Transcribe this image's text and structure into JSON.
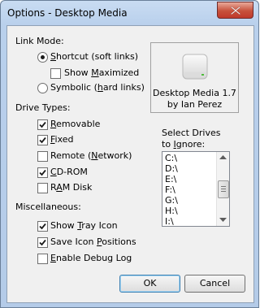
{
  "window": {
    "title": "Options - Desktop Media"
  },
  "link_mode": {
    "heading": "Link Mode:",
    "shortcut_pre": "",
    "shortcut_u": "S",
    "shortcut_post": "hortcut (soft links)",
    "show_maximized_pre": "Show ",
    "show_maximized_u": "M",
    "show_maximized_post": "aximized",
    "symbolic_pre": "Symbolic (",
    "symbolic_u": "h",
    "symbolic_post": "ard links)",
    "selected": "shortcut",
    "show_maximized_checked": false
  },
  "about": {
    "line1": "Desktop Media 1.7",
    "line2": "by Ian Perez"
  },
  "drive_types": {
    "heading": "Drive Types:",
    "items": [
      {
        "pre": "",
        "u": "R",
        "post": "emovable",
        "checked": true
      },
      {
        "pre": "",
        "u": "F",
        "post": "ixed",
        "checked": true
      },
      {
        "pre": "Remote (",
        "u": "N",
        "post": "etwork)",
        "checked": false
      },
      {
        "pre": "",
        "u": "C",
        "post": "D-ROM",
        "checked": true
      },
      {
        "pre": "R",
        "u": "A",
        "post": "M Disk",
        "checked": false
      }
    ]
  },
  "ignore_drives": {
    "label1": "Select Drives",
    "label2_pre": "to ",
    "label2_u": "I",
    "label2_post": "gnore:",
    "items": [
      "C:\\",
      "D:\\",
      "E:\\",
      "F:\\",
      "G:\\",
      "H:\\",
      "I:\\"
    ]
  },
  "misc": {
    "heading": "Miscellaneous:",
    "items": [
      {
        "pre": "Show ",
        "u": "T",
        "post": "ray Icon",
        "checked": true
      },
      {
        "pre": "Save Icon ",
        "u": "P",
        "post": "ositions",
        "checked": true
      },
      {
        "pre": "",
        "u": "E",
        "post": "nable Debug Log",
        "checked": false
      }
    ]
  },
  "buttons": {
    "ok": "OK",
    "cancel": "Cancel"
  }
}
